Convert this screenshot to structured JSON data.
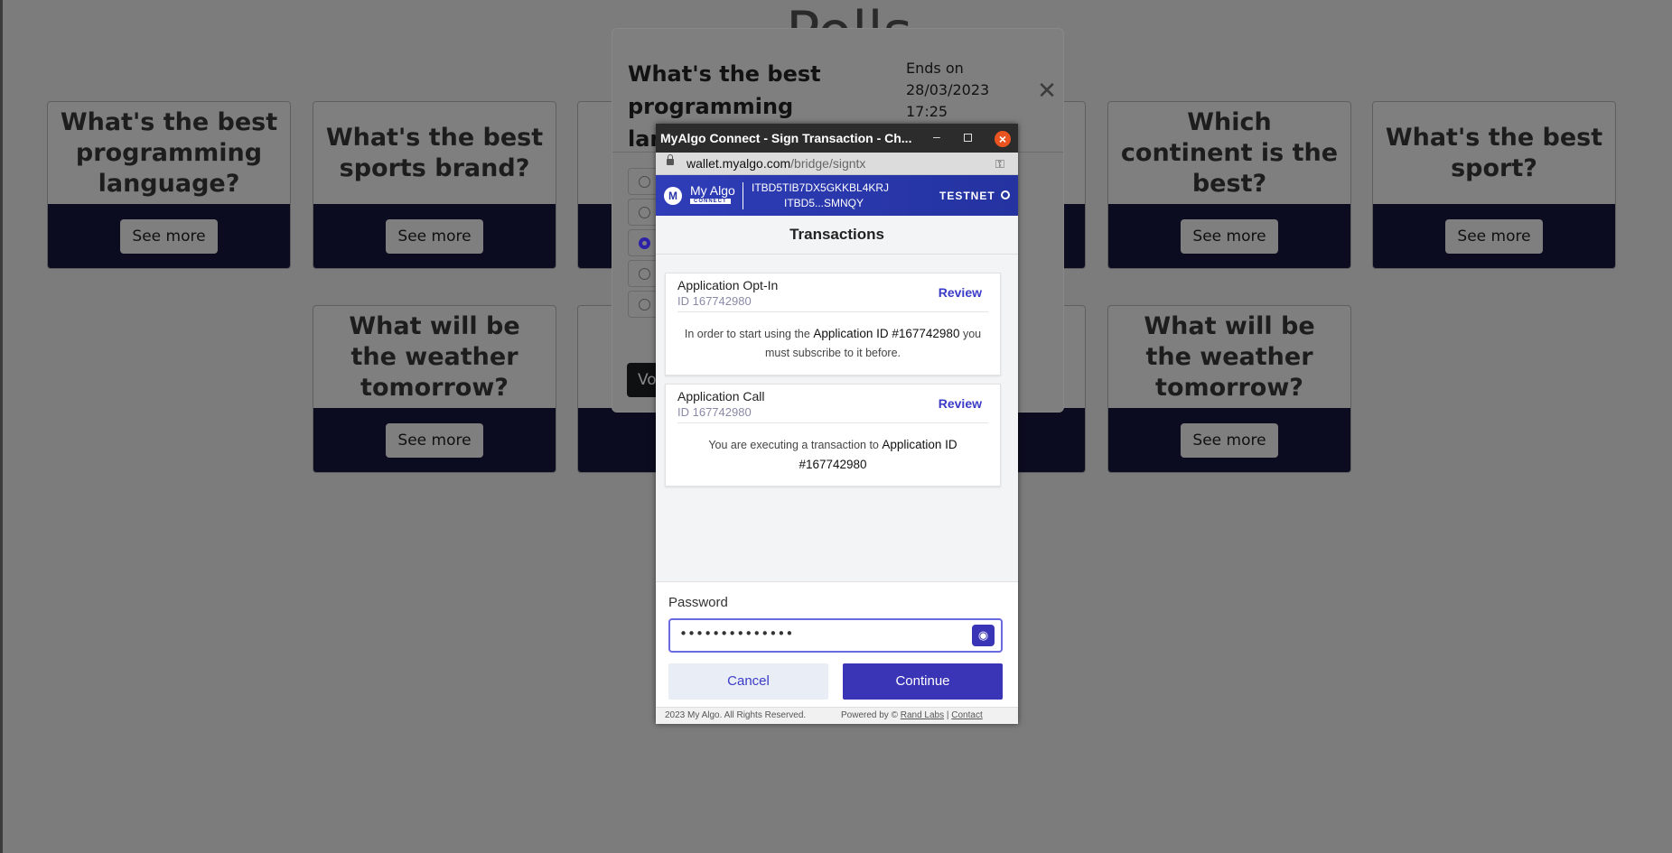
{
  "page": {
    "title": "Polls"
  },
  "cards": [
    {
      "title": "What's the best programming language?",
      "button": "See more"
    },
    {
      "title": "What's the best sports brand?",
      "button": "See more"
    },
    {
      "title": "Which continent is the best?",
      "button": "See more"
    },
    {
      "title": "What's the best sport?",
      "button": "See more"
    },
    {
      "title": "What will be the weather tomorrow?",
      "button": "See more"
    },
    {
      "title": "What will be the weather tomorrow?",
      "button": "See more"
    }
  ],
  "modal": {
    "title": "What's the best programming language?",
    "ends_label": "Ends on",
    "ends_date": "28/03/2023",
    "ends_time": "17:25",
    "vote_button": "Vo",
    "selected_option_index": 2
  },
  "popup": {
    "window_title": "MyAlgo Connect - Sign Transaction - Ch...",
    "url_host": "wallet.myalgo.com",
    "url_path": "/bridge/signtx",
    "brand_name": "My Algo",
    "brand_sub": "CONNECT",
    "address_full": "ITBD5TIB7DX5GKKBL4KRJ",
    "address_short": "ITBD5...SMNQY",
    "network": "TESTNET",
    "section_title": "Transactions",
    "transactions": [
      {
        "name": "Application Opt-In",
        "id": "ID 167742980",
        "review": "Review",
        "desc_prefix": "In order to start using the ",
        "desc_bold": "Application ID #167742980",
        "desc_suffix": " you must subscribe to it before."
      },
      {
        "name": "Application Call",
        "id": "ID 167742980",
        "review": "Review",
        "desc_prefix": "You are executing a transaction to ",
        "desc_bold": "Application ID #167742980",
        "desc_suffix": ""
      }
    ],
    "password_label": "Password",
    "password_value": "••••••••••••••",
    "cancel": "Cancel",
    "continue": "Continue",
    "footer_copy": "2023 My Algo. All Rights Reserved.",
    "footer_powered": "Powered by © ",
    "footer_randlabs": "Rand Labs",
    "footer_sep": " | ",
    "footer_contact": "Contact"
  }
}
